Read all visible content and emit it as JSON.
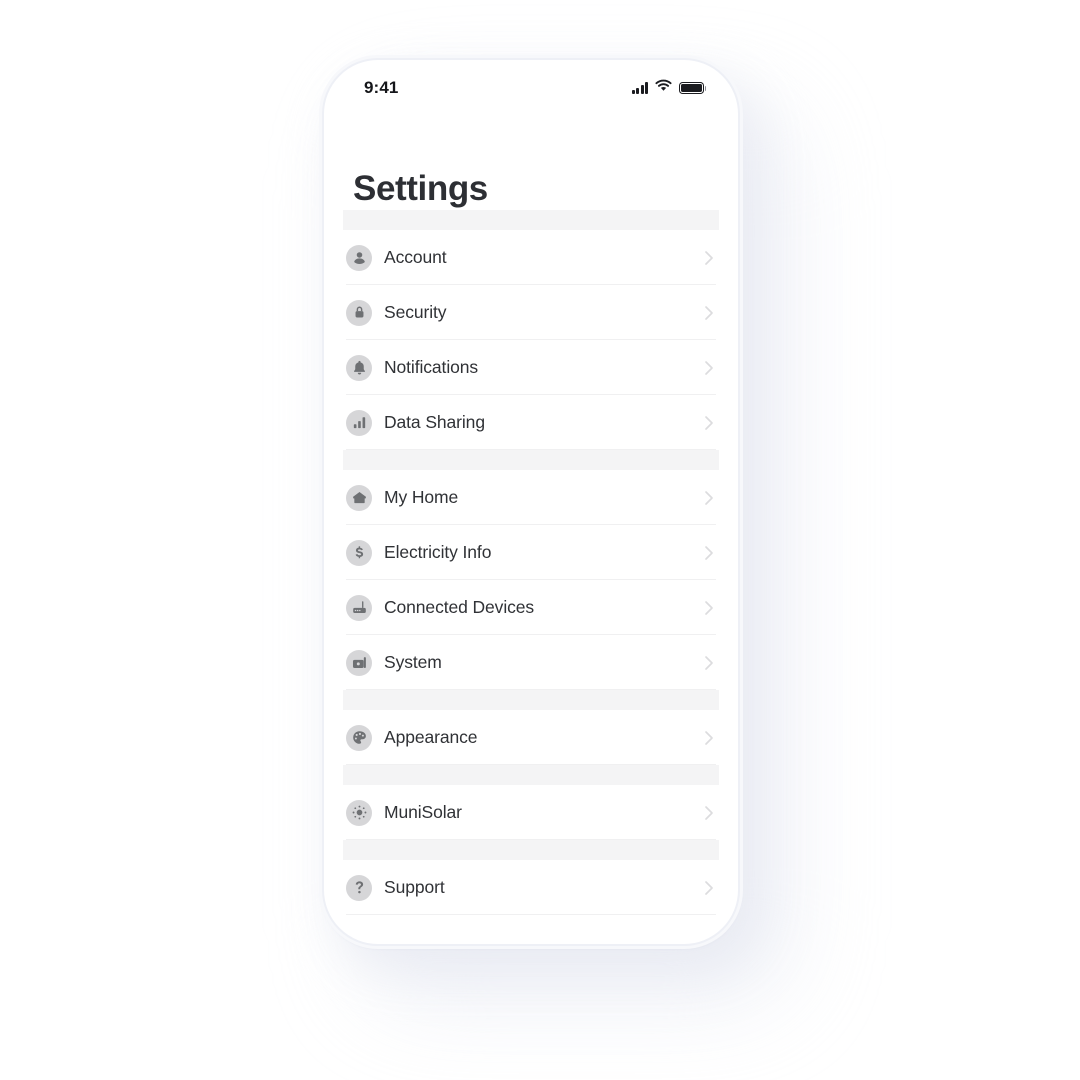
{
  "theme": {
    "accent": "#2d2f34",
    "icon_circle": "#d6d6d8",
    "icon_glyph": "#6e7073",
    "band": "#f4f4f5",
    "divider": "#f0f0f1",
    "chevron": "#dcdcde",
    "frame_shadow": "#e8eaf2"
  },
  "status_bar": {
    "time": "9:41",
    "signal_icon": "cellular-signal-icon",
    "wifi_icon": "wifi-icon",
    "battery_icon": "battery-full-icon"
  },
  "header": {
    "title": "Settings"
  },
  "list": {
    "chevron_icon": "chevron-right-icon",
    "groups": [
      {
        "id": "group-account",
        "items": [
          {
            "id": "account",
            "label": "Account",
            "icon": "person-icon"
          },
          {
            "id": "security",
            "label": "Security",
            "icon": "lock-icon"
          },
          {
            "id": "notifications",
            "label": "Notifications",
            "icon": "bell-icon"
          },
          {
            "id": "data-sharing",
            "label": "Data Sharing",
            "icon": "bar-chart-icon"
          }
        ]
      },
      {
        "id": "group-home",
        "items": [
          {
            "id": "my-home",
            "label": "My Home",
            "icon": "home-icon"
          },
          {
            "id": "electricity-info",
            "label": "Electricity Info",
            "icon": "dollar-icon"
          },
          {
            "id": "connected-devices",
            "label": "Connected Devices",
            "icon": "router-icon"
          },
          {
            "id": "system",
            "label": "System",
            "icon": "device-icon"
          }
        ]
      },
      {
        "id": "group-appearance",
        "items": [
          {
            "id": "appearance",
            "label": "Appearance",
            "icon": "palette-icon"
          }
        ]
      },
      {
        "id": "group-munisolar",
        "items": [
          {
            "id": "munisolar",
            "label": "MuniSolar",
            "icon": "sun-icon"
          }
        ]
      },
      {
        "id": "group-support",
        "items": [
          {
            "id": "support",
            "label": "Support",
            "icon": "question-mark-icon"
          }
        ]
      }
    ]
  }
}
